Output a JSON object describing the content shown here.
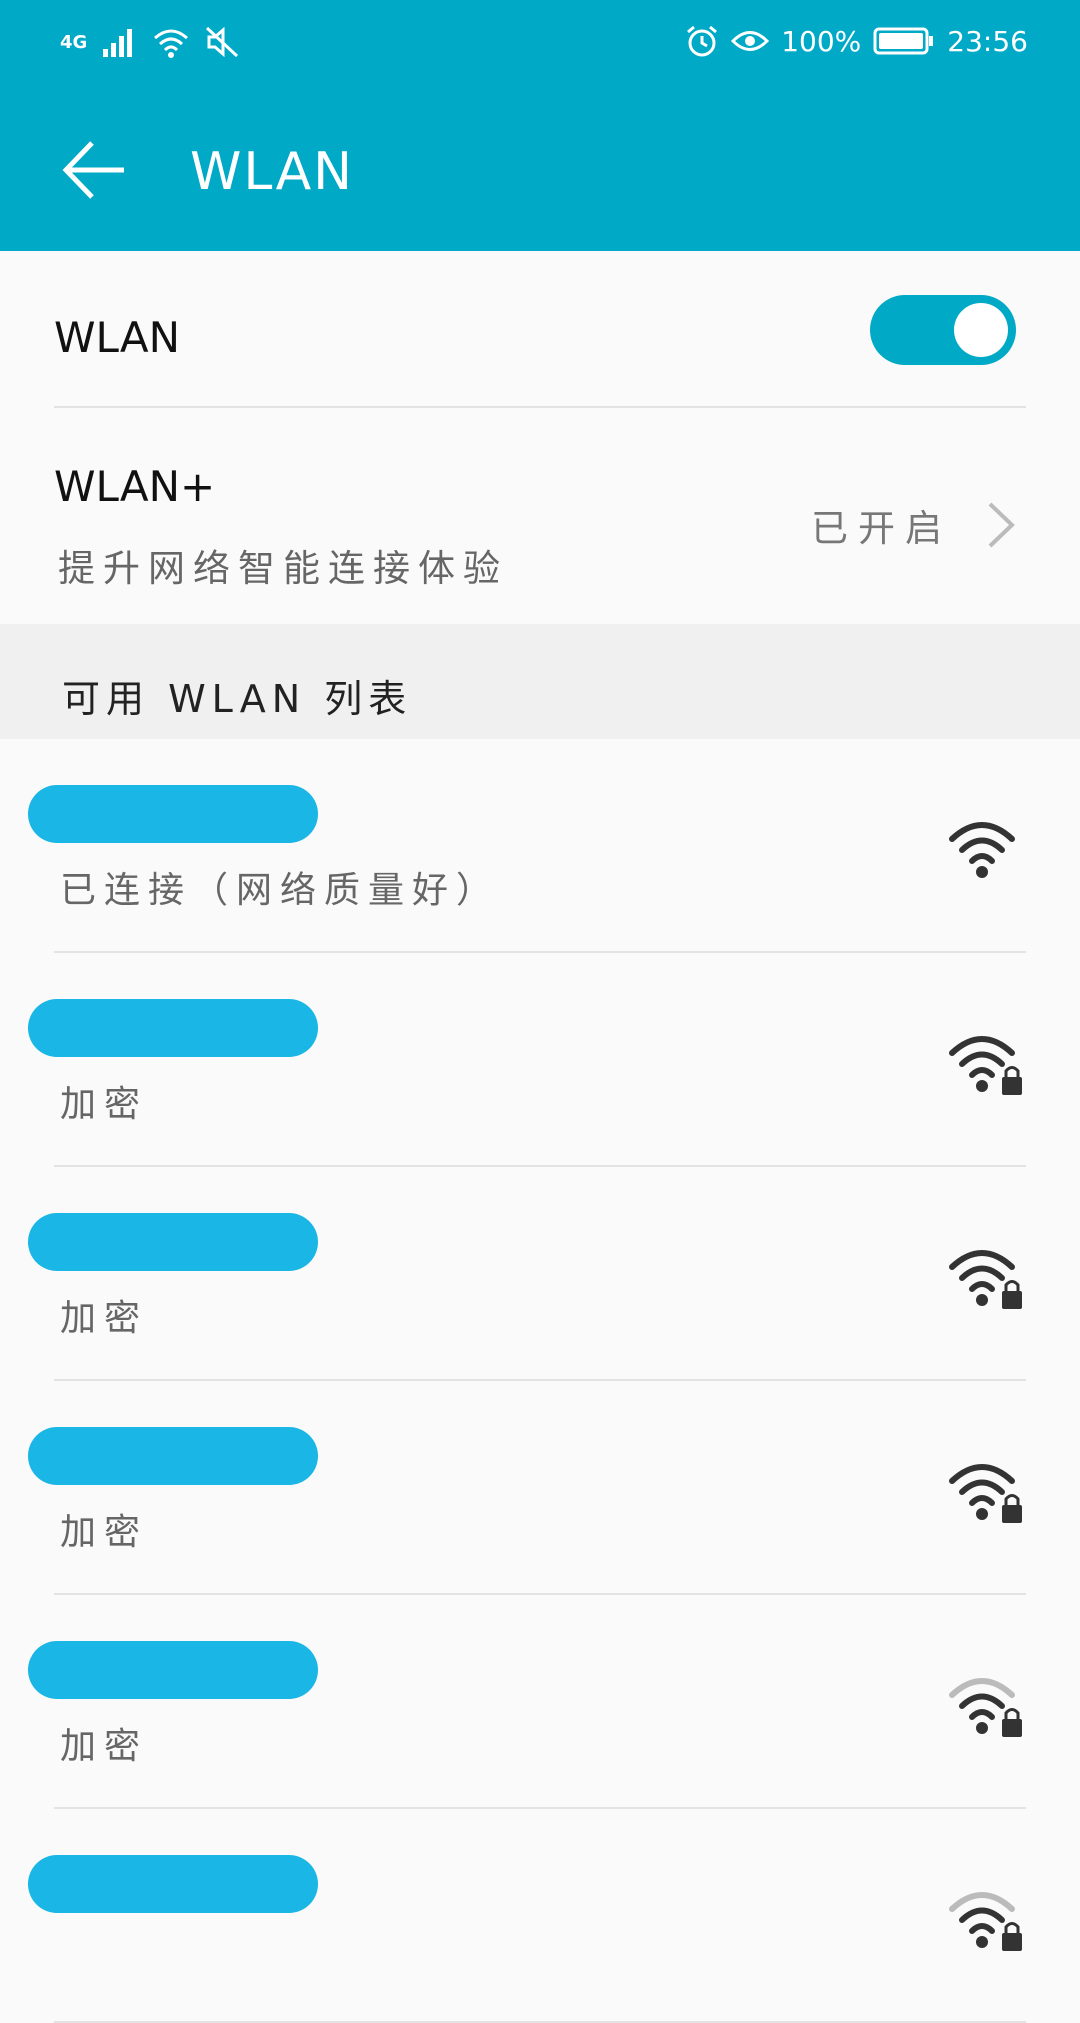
{
  "status_bar": {
    "network": "4G",
    "battery_percent": "100%",
    "time": "23:56"
  },
  "header": {
    "title": "WLAN"
  },
  "wlan_row": {
    "label": "WLAN",
    "toggle_on": true
  },
  "wlan_plus": {
    "label": "WLAN+",
    "subtitle": "提升网络智能连接体验",
    "value": "已开启"
  },
  "section": {
    "title": "可用 WLAN 列表"
  },
  "networks": [
    {
      "status": "已连接（网络质量好）",
      "locked": false,
      "signal": "strong"
    },
    {
      "status": "加密",
      "locked": true,
      "signal": "strong"
    },
    {
      "status": "加密",
      "locked": true,
      "signal": "strong"
    },
    {
      "status": "加密",
      "locked": true,
      "signal": "strong"
    },
    {
      "status": "加密",
      "locked": true,
      "signal": "medium"
    },
    {
      "status": "",
      "locked": true,
      "signal": "medium"
    }
  ],
  "colors": {
    "accent": "#00a9c6",
    "redaction": "#1ab6e6"
  }
}
